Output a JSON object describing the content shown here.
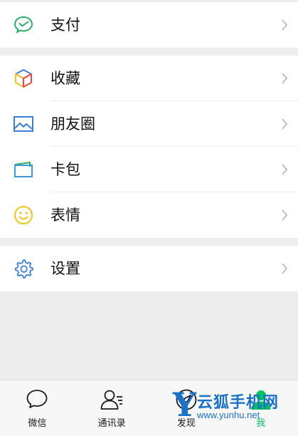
{
  "menu": {
    "pay": {
      "label": "支付",
      "icon": "wechat-pay-icon",
      "color": "#2aae67"
    },
    "favorites": {
      "label": "收藏",
      "icon": "cube-icon"
    },
    "moments": {
      "label": "朋友圈",
      "icon": "picture-icon",
      "color": "#3d7ed8"
    },
    "cards": {
      "label": "卡包",
      "icon": "card-icon",
      "color": "#3d9ad8"
    },
    "stickers": {
      "label": "表情",
      "icon": "smiley-icon",
      "color": "#f2c31e"
    },
    "settings": {
      "label": "设置",
      "icon": "gear-icon",
      "color": "#3d7ed8"
    }
  },
  "tabbar": {
    "tabs": [
      {
        "label": "微信",
        "icon": "chat-bubble-icon"
      },
      {
        "label": "通讯录",
        "icon": "contacts-icon"
      },
      {
        "label": "发现",
        "icon": "compass-icon"
      },
      {
        "label": "我",
        "icon": "person-icon",
        "active": true
      }
    ],
    "active_color": "#07c160"
  },
  "watermark": {
    "letter": "Y",
    "text": "云狐手机网",
    "url": "www.yunhu.net"
  }
}
